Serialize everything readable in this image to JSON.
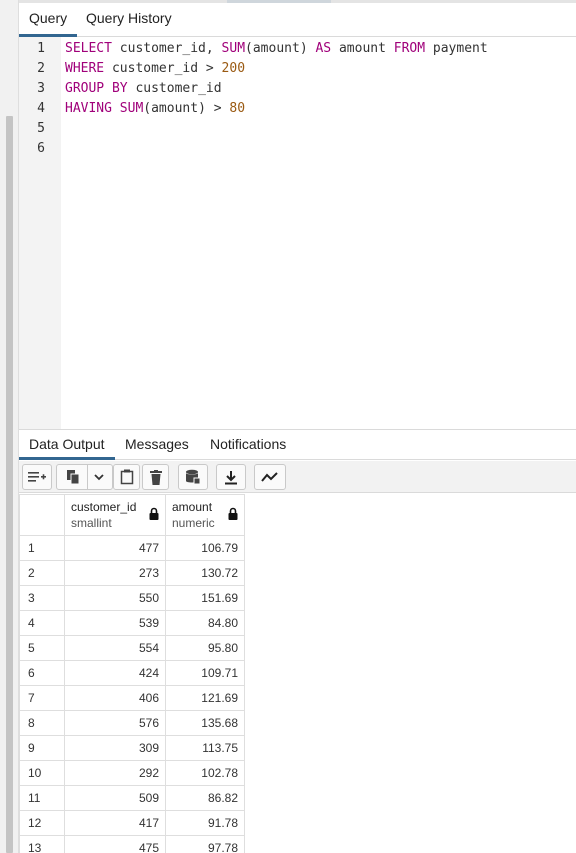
{
  "editor_tabs": [
    "Query",
    "Query History"
  ],
  "editor": {
    "line_numbers": [
      "1",
      "2",
      "3",
      "4",
      "5",
      "6"
    ],
    "lines": [
      [
        {
          "t": "SELECT",
          "c": "kw"
        },
        {
          "t": " customer_id, ",
          "c": ""
        },
        {
          "t": "SUM",
          "c": "kw"
        },
        {
          "t": "(amount) ",
          "c": ""
        },
        {
          "t": "AS",
          "c": "kw"
        },
        {
          "t": " amount ",
          "c": ""
        },
        {
          "t": "FROM",
          "c": "kw"
        },
        {
          "t": " payment",
          "c": ""
        }
      ],
      [
        {
          "t": "WHERE",
          "c": "kw"
        },
        {
          "t": " customer_id > ",
          "c": ""
        },
        {
          "t": "200",
          "c": "num"
        }
      ],
      [
        {
          "t": "GROUP BY",
          "c": "kw"
        },
        {
          "t": " customer_id",
          "c": ""
        }
      ],
      [
        {
          "t": "HAVING",
          "c": "kw"
        },
        {
          "t": " ",
          "c": ""
        },
        {
          "t": "SUM",
          "c": "kw"
        },
        {
          "t": "(amount) > ",
          "c": ""
        },
        {
          "t": "80",
          "c": "num"
        }
      ]
    ]
  },
  "output_tabs": [
    "Data Output",
    "Messages",
    "Notifications"
  ],
  "toolbar": {
    "buttons": [
      "add-row-icon",
      "copy-icon",
      "chevron-down-icon",
      "paste-icon",
      "delete-icon",
      "save-data-icon",
      "download-icon",
      "graph-icon"
    ]
  },
  "grid": {
    "columns": [
      {
        "name": "customer_id",
        "type": "smallint",
        "icon": "lock-icon"
      },
      {
        "name": "amount",
        "type": "numeric",
        "icon": "lock-icon"
      }
    ],
    "rows": [
      [
        "1",
        "477",
        "106.79"
      ],
      [
        "2",
        "273",
        "130.72"
      ],
      [
        "3",
        "550",
        "151.69"
      ],
      [
        "4",
        "539",
        "84.80"
      ],
      [
        "5",
        "554",
        "95.80"
      ],
      [
        "6",
        "424",
        "109.71"
      ],
      [
        "7",
        "406",
        "121.69"
      ],
      [
        "8",
        "576",
        "135.68"
      ],
      [
        "9",
        "309",
        "113.75"
      ],
      [
        "10",
        "292",
        "102.78"
      ],
      [
        "11",
        "509",
        "86.82"
      ],
      [
        "12",
        "417",
        "91.78"
      ],
      [
        "13",
        "475",
        "97.78"
      ]
    ]
  },
  "colors": {
    "keyword": "#a0007a",
    "number": "#9a5a12",
    "active_tab_underline": "#326690"
  }
}
